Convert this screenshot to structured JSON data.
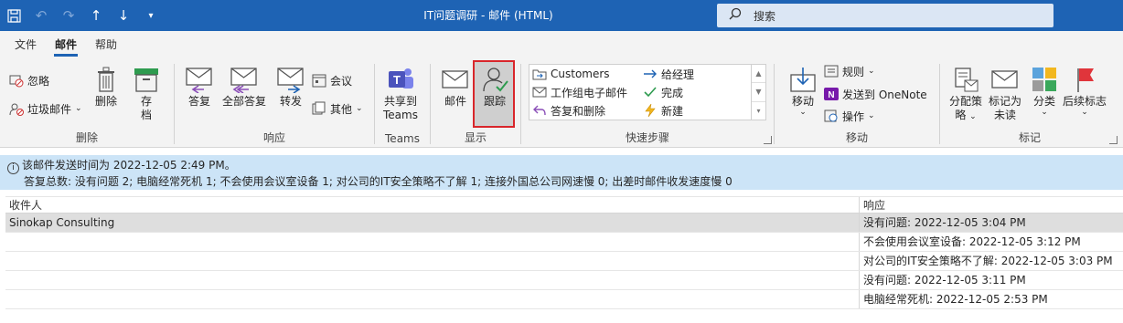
{
  "window": {
    "title": "IT问题调研 - 邮件 (HTML)"
  },
  "search": {
    "placeholder": "搜索"
  },
  "tabs": [
    {
      "label": "文件",
      "active": false
    },
    {
      "label": "邮件",
      "active": true
    },
    {
      "label": "帮助",
      "active": false
    }
  ],
  "ribbon": {
    "delete_group": {
      "label": "删除",
      "ignore": "忽略",
      "junk": "垃圾邮件",
      "delete": "删除",
      "archive_line1": "存",
      "archive_line2": "档"
    },
    "respond_group": {
      "label": "响应",
      "reply": "答复",
      "reply_all": "全部答复",
      "forward": "转发",
      "meeting": "会议",
      "more": "其他"
    },
    "teams_group": {
      "label": "Teams",
      "share_line1": "共享到",
      "share_line2": "Teams"
    },
    "show_group": {
      "label": "显示",
      "message": "邮件",
      "tracking": "跟踪"
    },
    "quicksteps_group": {
      "label": "快速步骤",
      "items": [
        "Customers",
        "给经理",
        "工作组电子邮件",
        "完成",
        "答复和删除",
        "新建"
      ]
    },
    "move_group": {
      "label": "移动",
      "move": "移动",
      "rules": "规则",
      "onenote": "发送到 OneNote",
      "actions": "操作"
    },
    "tags_group": {
      "label": "标记",
      "assign_line1": "分配策",
      "assign_line2": "略",
      "unread_line1": "标记为",
      "unread_line2": "未读",
      "categorize": "分类",
      "followup": "后续标志"
    }
  },
  "info": {
    "line1": "该邮件发送时间为 2022-12-05 2:49 PM。",
    "line2": "答复总数: 没有问题 2; 电脑经常死机 1; 不会使用会议室设备 1; 对公司的IT安全策略不了解 1; 连接外国总公司网速慢 0; 出差时邮件收发速度慢 0"
  },
  "table": {
    "columns": [
      "收件人",
      "响应"
    ],
    "rows": [
      {
        "recipient": "Sinokap Consulting",
        "response": "没有问题: 2022-12-05 3:04 PM"
      },
      {
        "recipient": "",
        "response": "不会使用会议室设备: 2022-12-05 3:12 PM"
      },
      {
        "recipient": "",
        "response": "对公司的IT安全策略不了解: 2022-12-05 3:03 PM"
      },
      {
        "recipient": "",
        "response": "没有问题: 2022-12-05 3:11 PM"
      },
      {
        "recipient": "",
        "response": "电脑经常死机: 2022-12-05 2:53 PM"
      }
    ]
  },
  "colors": {
    "titlebar": "#1e63b4",
    "accent": "#1e63b4",
    "infobar": "#cce4f7",
    "highlight": "#d9262b"
  }
}
